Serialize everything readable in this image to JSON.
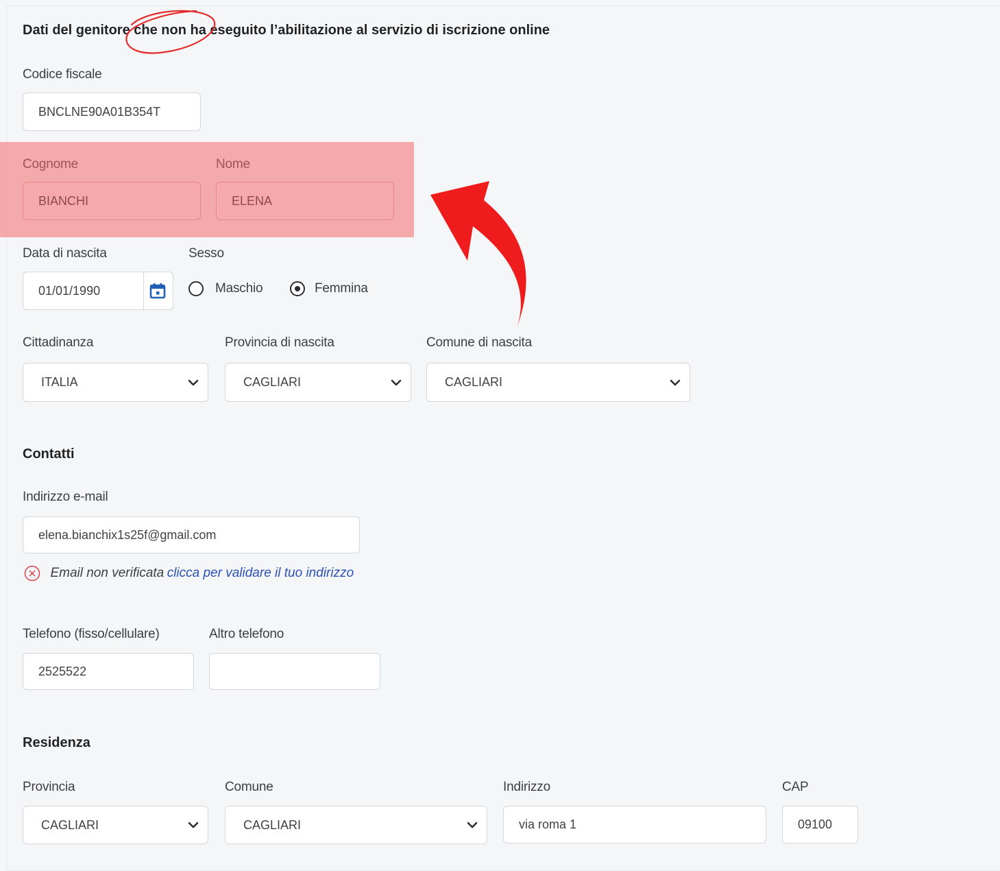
{
  "parent_section": {
    "title": "Dati del genitore che non ha eseguito l’abilitazione al servizio di iscrizione online",
    "codice_fiscale": {
      "label": "Codice fiscale",
      "value": "BNCLNE90A01B354T"
    },
    "cognome": {
      "label": "Cognome",
      "value": "BIANCHI"
    },
    "nome": {
      "label": "Nome",
      "value": "ELENA"
    },
    "data_nascita": {
      "label": "Data di nascita",
      "value": "01/01/1990"
    },
    "sesso": {
      "label": "Sesso",
      "options": [
        "Maschio",
        "Femmina"
      ],
      "selected": "Femmina"
    },
    "cittadinanza": {
      "label": "Cittadinanza",
      "value": "ITALIA"
    },
    "provincia_nascita": {
      "label": "Provincia di nascita",
      "value": "CAGLIARI"
    },
    "comune_nascita": {
      "label": "Comune di nascita",
      "value": "CAGLIARI"
    }
  },
  "contatti": {
    "title": "Contatti",
    "email": {
      "label": "Indirizzo e-mail",
      "value": "elena.bianchix1s25f@gmail.com"
    },
    "email_status": {
      "message": "Email non verificata",
      "link": "clicca per validare il tuo indirizzo"
    },
    "telefono": {
      "label": "Telefono (fisso/cellulare)",
      "value": "2525522"
    },
    "altro_telefono": {
      "label": "Altro telefono",
      "value": ""
    }
  },
  "residenza": {
    "title": "Residenza",
    "provincia": {
      "label": "Provincia",
      "value": "CAGLIARI"
    },
    "comune": {
      "label": "Comune",
      "value": "CAGLIARI"
    },
    "indirizzo": {
      "label": "Indirizzo",
      "value": "via roma 1"
    },
    "cap": {
      "label": "CAP",
      "value": "09100"
    }
  },
  "annotation_colors": {
    "highlight": "#f3696e",
    "arrow": "#ee1c1c",
    "circle": "#e32b2b"
  },
  "icons": {
    "calendar": "calendar-icon",
    "chevron": "chevron-down-icon",
    "error": "error-circle-icon"
  }
}
